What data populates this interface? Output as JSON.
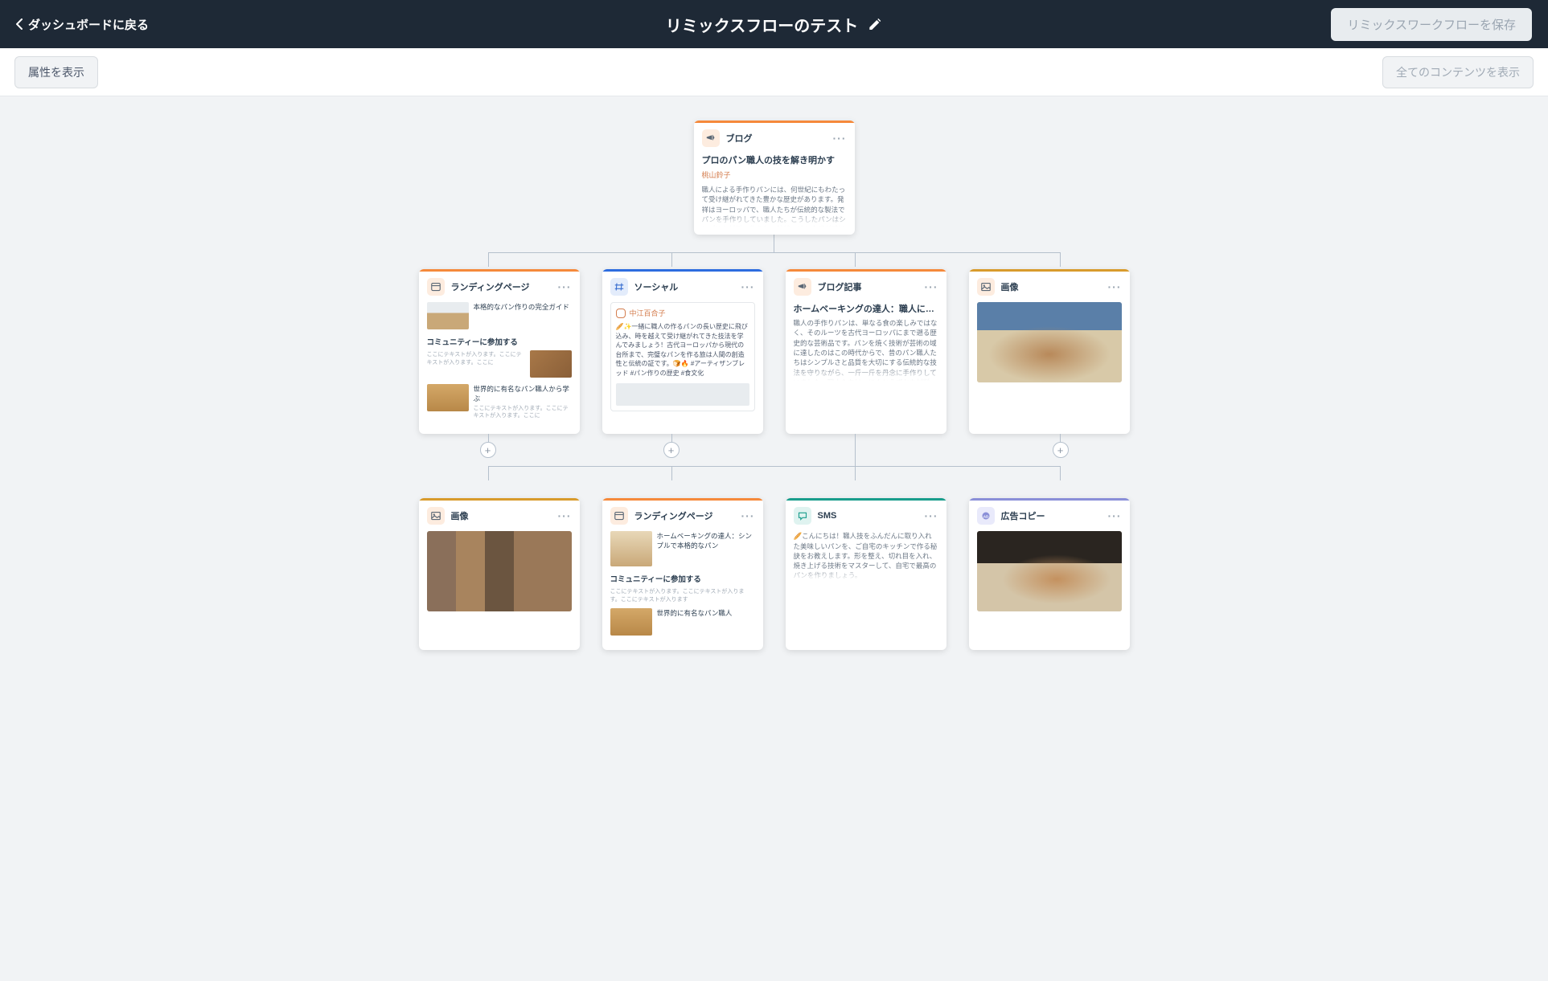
{
  "topbar": {
    "back": "ダッシュボードに戻る",
    "title": "リミックスフローのテスト",
    "save": "リミックスワークフローを保存"
  },
  "toolbar": {
    "showAttrs": "属性を表示",
    "showAll": "全てのコンテンツを表示"
  },
  "root": {
    "type": "ブログ",
    "title": "プロのパン職人の技を解き明かす",
    "author": "桃山鈴子",
    "body": "職人による手作りパンには、何世紀にもわたって受け継がれてきた豊かな歴史があります。発祥はヨーロッパで、職人たちが伝統的な製法でパンを手作りしていました。こうしたパンはシンプルな材料で作られ、独特の味と食感が感じられるものでした。やがて職人の"
  },
  "level2": {
    "lp": {
      "type": "ランディングページ",
      "h1": "本格的なパン作りの完全ガイド",
      "h2": "コミュニティーに参加する",
      "h3": "世界的に有名なパン職人から学ぶ",
      "sub": "ここにテキストが入ります。ここにテキストが入ります。ここに"
    },
    "social": {
      "type": "ソーシャル",
      "user": "中江百合子",
      "body": "🥖✨一緒に職人の作るパンの長い歴史に飛び込み、時を越えて受け継がれてきた技法を学んでみましょう！古代ヨーロッパから現代の台所まで、完璧なパンを作る旅は人間の創造性と伝統の証です。🍞🔥 #アーティザンブレッド #パン作りの歴史 #食文化"
    },
    "blog": {
      "type": "ブログ記事",
      "title": "ホームベーキングの達人：職人によ...",
      "body": "職人の手作りパンは、単なる食の楽しみではなく、そのルーツを古代ヨーロッパにまで遡る歴史的な芸術品です。パンを焼く技術が芸術の域に達したのはこの時代からで、昔のパン職人たちはシンプルさと品質を大切にする伝統的な技法を守りながら、一斤一斤を丹念に手作りしていました。職人たちは、ほんとうずかな材料で、栄養価が高いだけでなく、それ自体なでは"
    },
    "image": {
      "type": "画像"
    }
  },
  "level3": {
    "image": {
      "type": "画像"
    },
    "lp": {
      "type": "ランディングページ",
      "h1": "ホームベーキングの達人：シンプルで本格的なパン",
      "h2": "コミュニティーに参加する",
      "h3": "世界的に有名なパン職人",
      "sub": "ここにテキストが入ります。ここにテキストが入ります。ここにテキストが入ります"
    },
    "sms": {
      "type": "SMS",
      "body": "🥖こんにちは！職人技をふんだんに取り入れた美味しいパンを、ご自宅のキッチンで作る秘訣をお教えします。形を整え、切れ目を入れ、焼き上げる技術をマスターして、自宅で最高のパンを作りましょう。"
    },
    "ad": {
      "type": "広告コピー"
    }
  }
}
